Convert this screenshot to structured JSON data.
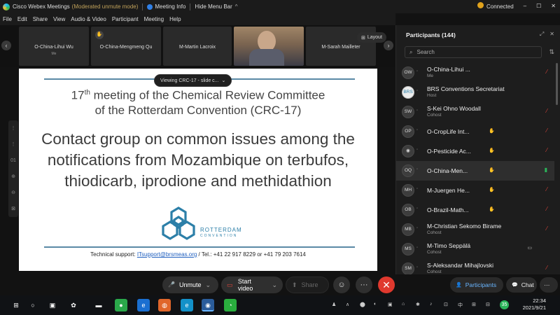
{
  "titlebar": {
    "app": "Cisco Webex Meetings",
    "mode": "(Moderated unmute mode)",
    "meeting_info": "Meeting Info",
    "hide_menu": "Hide Menu Bar",
    "hide_chevron": "^",
    "status": "Connected",
    "min": "–",
    "max": "☐",
    "close": "✕"
  },
  "menu": [
    "File",
    "Edit",
    "Share",
    "View",
    "Audio & Video",
    "Participant",
    "Meeting",
    "Help"
  ],
  "strip": {
    "prev": "‹",
    "next": "›",
    "tiles": [
      {
        "name": "O-China-Lihui Wu",
        "sub": "Me"
      },
      {
        "name": "O-China-Mengmeng Qu",
        "sub": ""
      },
      {
        "name": "M-Martin Lacroix",
        "sub": ""
      },
      {
        "name": "",
        "sub": ""
      },
      {
        "name": "M-Sarah Mailleter",
        "sub": ""
      }
    ],
    "layout_label": "Layout",
    "layout_icon": "⊞"
  },
  "viewing": {
    "label": "Viewing CRC-17 - slide c...",
    "chevron": "⌄"
  },
  "lefttools": [
    "⋮",
    "⋮",
    "01",
    "⊕",
    "⊖",
    "⊠"
  ],
  "slide": {
    "meeting_line1": "meeting of the Chemical Review Committee",
    "ordinal": "17",
    "ordinal_suffix": "th",
    "meeting_line2": "of the Rotterdam Convention (CRC-17)",
    "headline": "Contact group on common issues among the notifications from Mozambique on terbufos, thiodicarb, iprodione and methidathion",
    "logo_text1": "ROTTERDAM",
    "logo_text2": "CONVENTION",
    "support_prefix": "Technical support: ",
    "support_email": "ITsupport@brsmeas.org",
    "support_suffix": " /  Tel.: +41 22 917 8229 or +41 79 203 7614"
  },
  "controls": {
    "unmute": "Unmute",
    "start_video": "Start video",
    "share": "Share",
    "mute_icon": "🎤",
    "video_icon": "▭",
    "share_icon": "⬆",
    "dropdown": "⌄",
    "reactions": "☺",
    "more": "···",
    "end": "✕"
  },
  "panel": {
    "title": "Participants (144)",
    "popout": "⤢",
    "close": "✕",
    "search_placeholder": "Search",
    "search_icon": "⌕",
    "sort_icon": "⇅",
    "participants": [
      {
        "initials": "OW",
        "name": "O-China-Lihui ...",
        "role": "Me",
        "hand": "",
        "mute": "on",
        "cam": ""
      },
      {
        "initials": "BRS",
        "name": "BRS Conventions Secretariat",
        "role": "Host",
        "hand": "",
        "mute": "",
        "cam": ""
      },
      {
        "initials": "SW",
        "name": "S-Kei Ohno Woodall",
        "role": "Cohost",
        "hand": "",
        "mute": "on",
        "cam": ""
      },
      {
        "initials": "OP",
        "name": "O-CropLife Int...",
        "role": "",
        "hand": "✋",
        "mute": "on",
        "cam": ""
      },
      {
        "initials": "◉",
        "name": "O-Pesticide Ac...",
        "role": "",
        "hand": "✋",
        "mute": "on",
        "cam": ""
      },
      {
        "initials": "OQ",
        "name": "O-China-Men...",
        "role": "",
        "hand": "✋",
        "mute": "off",
        "cam": ""
      },
      {
        "initials": "MH",
        "name": "M-Juergen He...",
        "role": "",
        "hand": "✋",
        "mute": "on",
        "cam": ""
      },
      {
        "initials": "OB",
        "name": "O-Brazil-Math...",
        "role": "",
        "hand": "✋",
        "mute": "on",
        "cam": ""
      },
      {
        "initials": "MB",
        "name": "M-Christian Sekomo Birame",
        "role": "Cohost",
        "hand": "",
        "mute": "on",
        "cam": ""
      },
      {
        "initials": "MS",
        "name": "M-Timo Seppälä",
        "role": "Cohost",
        "hand": "",
        "mute": "",
        "cam": "▭"
      },
      {
        "initials": "SM",
        "name": "S-Aleksandar Mihajlovski",
        "role": "Cohost",
        "hand": "",
        "mute": "on",
        "cam": ""
      }
    ],
    "mute_glyph": "⁄",
    "participants_btn": "Participants",
    "participants_icon": "👤",
    "chat_btn": "Chat",
    "chat_icon": "💬",
    "more": "···"
  },
  "taskbar": {
    "icons": [
      {
        "name": "windows-start-icon",
        "glyph": "⊞",
        "bg": "#101215"
      },
      {
        "name": "search-circle-icon",
        "glyph": "○",
        "bg": "#101215"
      },
      {
        "name": "task-view-icon",
        "glyph": "▣",
        "bg": "#101215"
      },
      {
        "name": "pinwheel-app-icon",
        "glyph": "✿",
        "bg": "#101215"
      },
      {
        "name": "file-explorer-icon",
        "glyph": "▬",
        "bg": "#d9a b2b"
      },
      {
        "name": "green-app-icon",
        "glyph": "●",
        "bg": "#2aa84a"
      },
      {
        "name": "edge-legacy-icon",
        "glyph": "e",
        "bg": "#1a6fd1"
      },
      {
        "name": "firefox-icon",
        "glyph": "◍",
        "bg": "#e0662a"
      },
      {
        "name": "edge-icon",
        "glyph": "e",
        "bg": "#1391c9"
      },
      {
        "name": "webex-app-icon",
        "glyph": "◉",
        "bg": "#2a5c9a"
      },
      {
        "name": "wechat-icon",
        "glyph": "◔",
        "bg": "#2aae3e"
      }
    ],
    "time": "22:34",
    "date": "2021/9/21",
    "tray": [
      "♟",
      "∧",
      "⬤",
      "◐",
      "▣",
      "⌂",
      "✱",
      "♪",
      "⊡",
      "中",
      "⊞",
      "⊟",
      "35"
    ]
  }
}
